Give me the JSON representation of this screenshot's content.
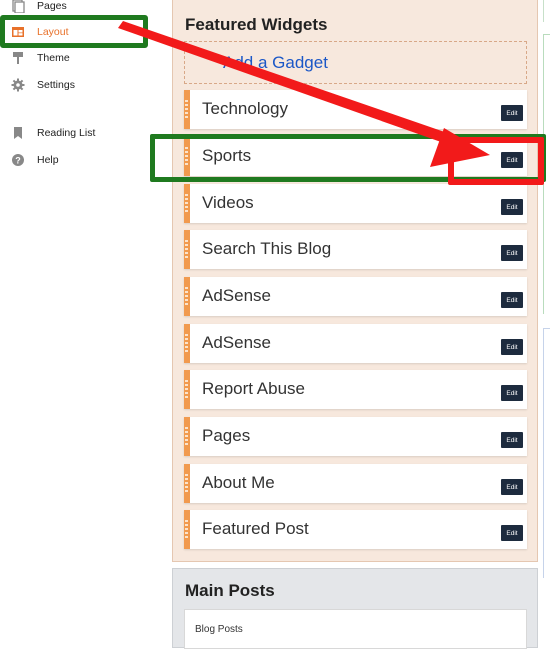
{
  "sidebar": {
    "items": [
      {
        "label": "Pages",
        "icon": "pages-icon"
      },
      {
        "label": "Layout",
        "icon": "layout-icon",
        "active": true
      },
      {
        "label": "Theme",
        "icon": "theme-icon"
      },
      {
        "label": "Settings",
        "icon": "settings-icon"
      },
      {
        "label": "Reading List",
        "icon": "bookmark-icon"
      },
      {
        "label": "Help",
        "icon": "help-icon"
      }
    ]
  },
  "featured": {
    "title": "Featured Widgets",
    "add_gadget": "Add a Gadget",
    "gadgets": [
      {
        "label": "Technology",
        "edit": "Edit"
      },
      {
        "label": "Sports",
        "edit": "Edit"
      },
      {
        "label": "Videos",
        "edit": "Edit"
      },
      {
        "label": "Search This Blog",
        "edit": "Edit"
      },
      {
        "label": "AdSense",
        "edit": "Edit"
      },
      {
        "label": "AdSense",
        "edit": "Edit"
      },
      {
        "label": "Report Abuse",
        "edit": "Edit"
      },
      {
        "label": "Pages",
        "edit": "Edit"
      },
      {
        "label": "About Me",
        "edit": "Edit"
      },
      {
        "label": "Featured Post",
        "edit": "Edit"
      }
    ]
  },
  "main": {
    "title": "Main Posts",
    "blog_posts": "Blog Posts"
  },
  "colors": {
    "accent": "#e8712a",
    "gadget_border": "#f19a4f",
    "annotation_green": "#1f7a1f",
    "annotation_red": "#f21a1a",
    "link_blue": "#1b57c7"
  }
}
